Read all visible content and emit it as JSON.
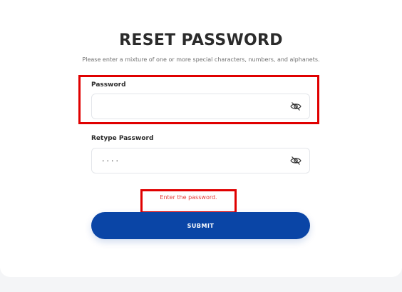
{
  "form": {
    "title": "RESET PASSWORD",
    "subtitle": "Please enter a mixture of one or more special characters, numbers, and alphanets.",
    "password": {
      "label": "Password",
      "value": "",
      "toggle_icon": "eye-off-icon"
    },
    "retype_password": {
      "label": "Retype Password",
      "value": "····",
      "toggle_icon": "eye-off-icon"
    },
    "error_message": "Enter the password.",
    "submit_label": "SUBMIT"
  },
  "colors": {
    "accent": "#0a45a6",
    "error": "#e53935",
    "highlight": "#e00000"
  }
}
